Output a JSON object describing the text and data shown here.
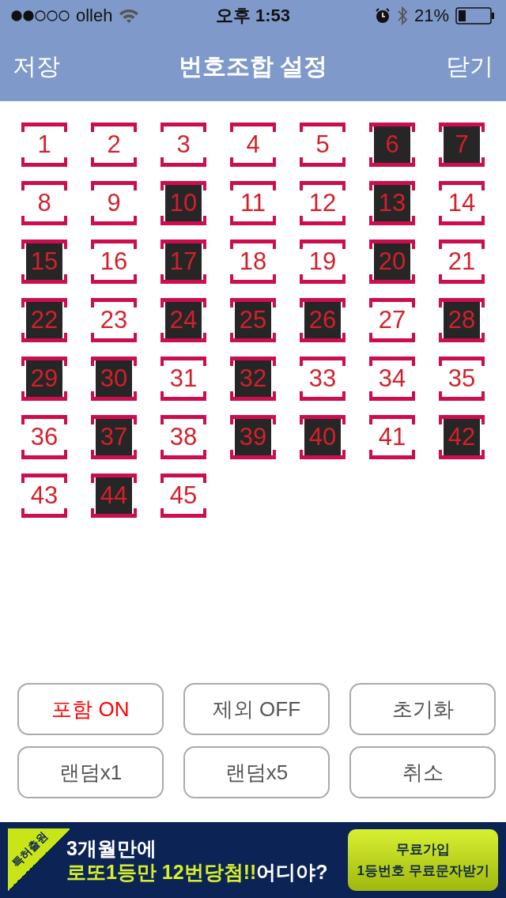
{
  "status_bar": {
    "carrier": "olleh",
    "time": "오후 1:53",
    "battery": "21%"
  },
  "nav": {
    "left": "저장",
    "title": "번호조합 설정",
    "right": "닫기"
  },
  "numbers": [
    {
      "label": "1",
      "selected": false
    },
    {
      "label": "2",
      "selected": false
    },
    {
      "label": "3",
      "selected": false
    },
    {
      "label": "4",
      "selected": false
    },
    {
      "label": "5",
      "selected": false
    },
    {
      "label": "6",
      "selected": true
    },
    {
      "label": "7",
      "selected": true
    },
    {
      "label": "8",
      "selected": false
    },
    {
      "label": "9",
      "selected": false
    },
    {
      "label": "10",
      "selected": true
    },
    {
      "label": "11",
      "selected": false
    },
    {
      "label": "12",
      "selected": false
    },
    {
      "label": "13",
      "selected": true
    },
    {
      "label": "14",
      "selected": false
    },
    {
      "label": "15",
      "selected": true
    },
    {
      "label": "16",
      "selected": false
    },
    {
      "label": "17",
      "selected": true
    },
    {
      "label": "18",
      "selected": false
    },
    {
      "label": "19",
      "selected": false
    },
    {
      "label": "20",
      "selected": true
    },
    {
      "label": "21",
      "selected": false
    },
    {
      "label": "22",
      "selected": true
    },
    {
      "label": "23",
      "selected": false
    },
    {
      "label": "24",
      "selected": true
    },
    {
      "label": "25",
      "selected": true
    },
    {
      "label": "26",
      "selected": true
    },
    {
      "label": "27",
      "selected": false
    },
    {
      "label": "28",
      "selected": true
    },
    {
      "label": "29",
      "selected": true
    },
    {
      "label": "30",
      "selected": true
    },
    {
      "label": "31",
      "selected": false
    },
    {
      "label": "32",
      "selected": true
    },
    {
      "label": "33",
      "selected": false
    },
    {
      "label": "34",
      "selected": false
    },
    {
      "label": "35",
      "selected": false
    },
    {
      "label": "36",
      "selected": false
    },
    {
      "label": "37",
      "selected": true
    },
    {
      "label": "38",
      "selected": false
    },
    {
      "label": "39",
      "selected": true
    },
    {
      "label": "40",
      "selected": true
    },
    {
      "label": "41",
      "selected": false
    },
    {
      "label": "42",
      "selected": true
    },
    {
      "label": "43",
      "selected": false
    },
    {
      "label": "44",
      "selected": true
    },
    {
      "label": "45",
      "selected": false
    }
  ],
  "buttons": [
    {
      "label": "포함 ON",
      "on": true
    },
    {
      "label": "제외 OFF",
      "on": false
    },
    {
      "label": "초기화",
      "on": false
    },
    {
      "label": "랜덤x1",
      "on": false
    },
    {
      "label": "랜덤x5",
      "on": false
    },
    {
      "label": "취소",
      "on": false
    }
  ],
  "ad": {
    "tag": "특허출원",
    "line1": "3개월만에",
    "line2_highlight": "로또1등만 12번당첨!!",
    "line2_rest": "어디야?",
    "cta_line1": "무료가입",
    "cta_line2": "1등번호 무료문자받기"
  }
}
